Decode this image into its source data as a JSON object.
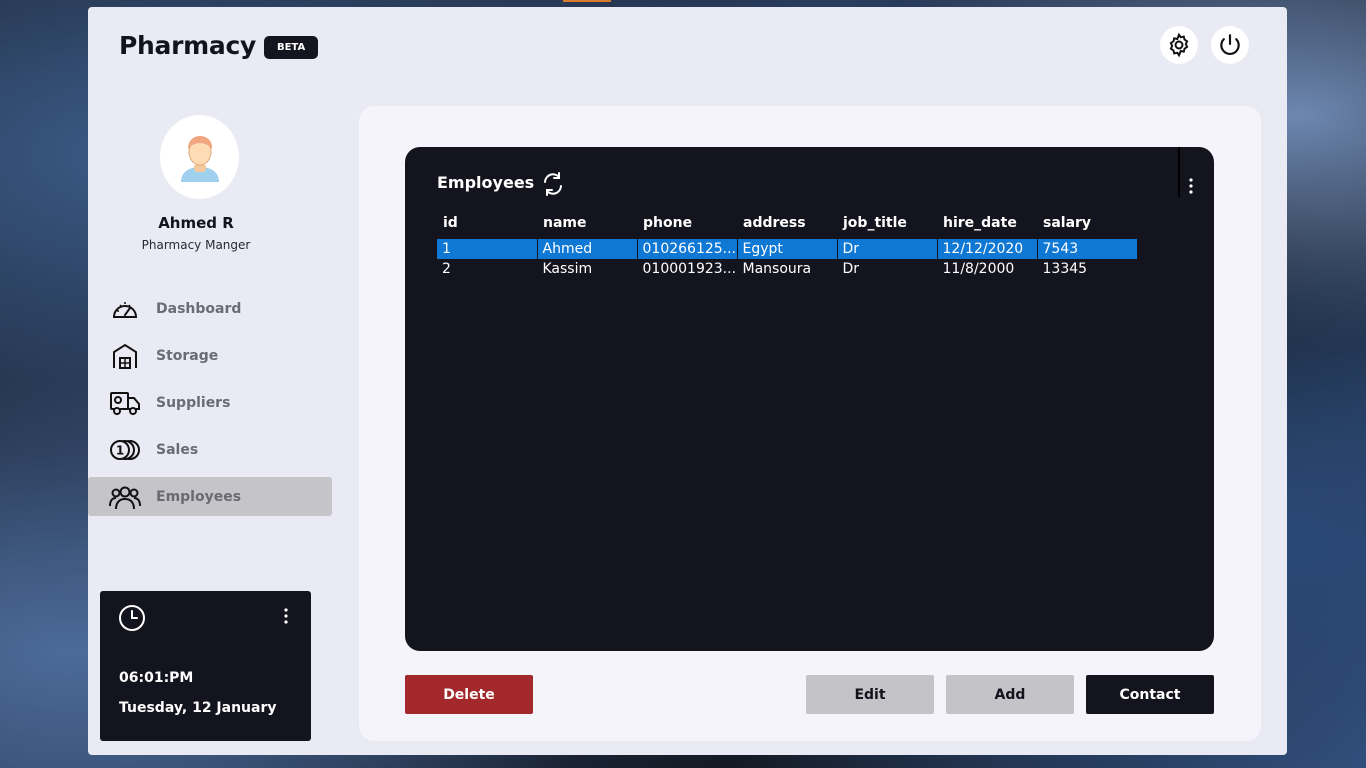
{
  "app": {
    "title": "Pharmacy",
    "badge": "BETA"
  },
  "user": {
    "name": "Ahmed R",
    "role": "Pharmacy Manger"
  },
  "sidebar": {
    "items": [
      {
        "label": "Dashboard",
        "icon": "dashboard-gauge-icon",
        "active": false
      },
      {
        "label": "Storage",
        "icon": "warehouse-icon",
        "active": false
      },
      {
        "label": "Suppliers",
        "icon": "delivery-truck-icon",
        "active": false
      },
      {
        "label": "Sales",
        "icon": "coins-icon",
        "active": false
      },
      {
        "label": "Employees",
        "icon": "people-group-icon",
        "active": true
      }
    ]
  },
  "clock": {
    "time": "06:01:PM",
    "date": "Tuesday, 12 January"
  },
  "table": {
    "title": "Employees",
    "columns": [
      "id",
      "name",
      "phone",
      "address",
      "job_title",
      "hire_date",
      "salary"
    ],
    "rows": [
      [
        "1",
        "Ahmed",
        "010266125...",
        "Egypt",
        "Dr",
        "12/12/2020",
        "7543"
      ],
      [
        "2",
        "Kassim",
        "010001923...",
        "Mansoura",
        "Dr",
        "11/8/2000",
        "13345"
      ]
    ],
    "selected_row": 0
  },
  "buttons": {
    "delete": "Delete",
    "edit": "Edit",
    "add": "Add",
    "contact": "Contact"
  },
  "colors": {
    "accent_selected": "#0f78d4",
    "delete": "#a2282b",
    "dark": "#14141f",
    "panel": "#e9eaf3"
  }
}
